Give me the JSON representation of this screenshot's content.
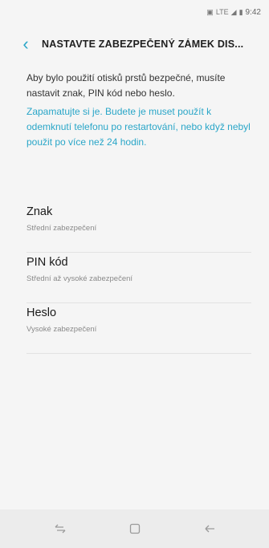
{
  "status_bar": {
    "icons": [
      "nfc-icon",
      "lte-icon",
      "signal-icon",
      "battery-icon"
    ],
    "lte": "LTE",
    "time": "9:42"
  },
  "header": {
    "back_icon": "chevron-left-icon",
    "title": "NASTAVTE ZABEZPEČENÝ ZÁMEK DIS..."
  },
  "main": {
    "description": "Aby bylo použití otisků prstů bezpečné, musíte nastavit znak, PIN kód nebo heslo.",
    "note": "Zapamatujte si je. Budete je muset použít k odemknutí telefonu po restartování, nebo když nebyl použit po více než 24 hodin."
  },
  "options": [
    {
      "title": "Znak",
      "subtitle": "Střední zabezpečení"
    },
    {
      "title": "PIN kód",
      "subtitle": "Střední až vysoké zabezpečení"
    },
    {
      "title": "Heslo",
      "subtitle": "Vysoké zabezpečení"
    }
  ],
  "nav": {
    "recent_icon": "recent-apps-icon",
    "home_icon": "home-icon",
    "back_icon": "back-arrow-icon"
  },
  "colors": {
    "accent": "#2aa6c8"
  }
}
